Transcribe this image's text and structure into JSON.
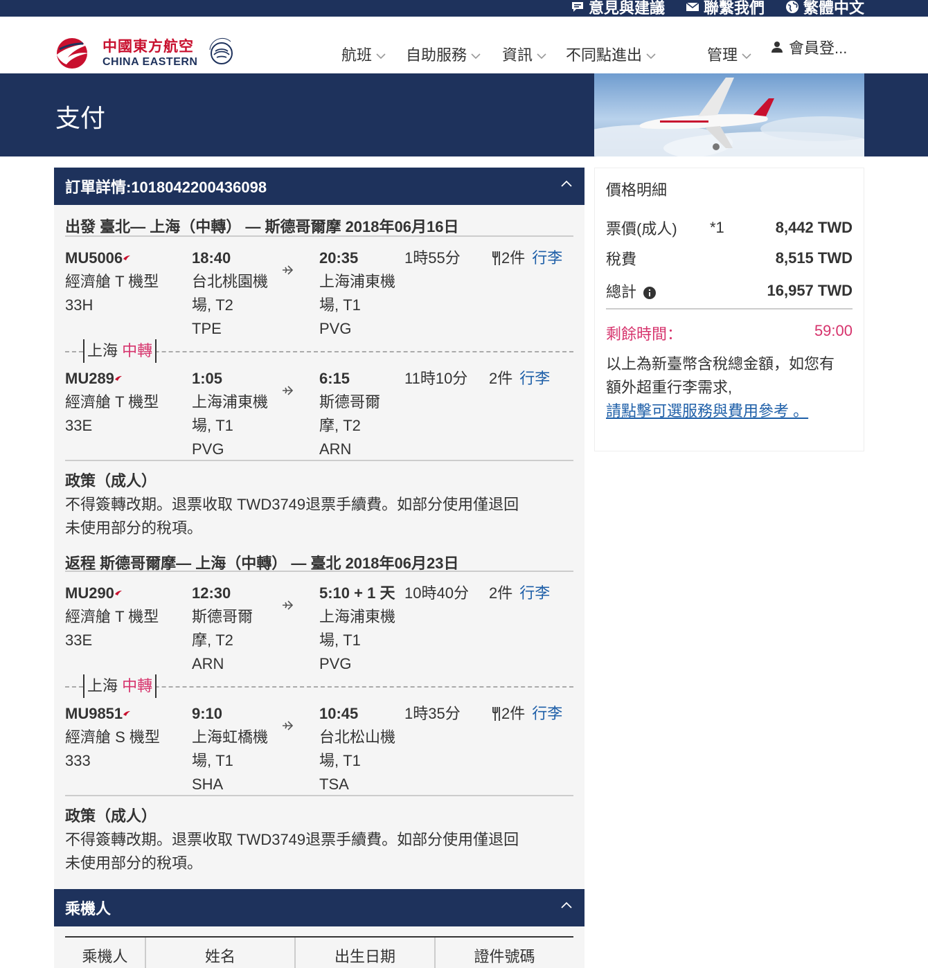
{
  "topbar": {
    "feedback": "意見與建議",
    "contact": "聯繫我們",
    "language": "繁體中文"
  },
  "brand": {
    "cn": "中國東方航空",
    "en": "CHINA EASTERN",
    "alliance": "SKYTEAM"
  },
  "nav": {
    "items": [
      "航班",
      "自助服務",
      "資訊",
      "不同點進出",
      "管理"
    ],
    "member": "會員登..."
  },
  "hero": {
    "title": "支付"
  },
  "order": {
    "header": "訂單詳情:1018042200436098",
    "outbound": {
      "title": "出發 臺北— 上海（中轉） — 斯德哥爾摩 2018年06月16日",
      "transfer_city": "上海",
      "transfer_label": "中轉",
      "flights": [
        {
          "number": "MU5006",
          "cabin": "經濟艙 T 機型",
          "aircraft": "33H",
          "dep_time": "18:40",
          "dep_airport_1": "台北桃園機",
          "dep_airport_2": "場, T2",
          "dep_code": "TPE",
          "arr_time": "20:35",
          "arr_airport_1": "上海浦東機",
          "arr_airport_2": "場, T1",
          "arr_code": "PVG",
          "duration": "1時55分",
          "bags": "2件",
          "bags_link": "行李"
        },
        {
          "number": "MU289",
          "cabin": "經濟艙 T 機型",
          "aircraft": "33E",
          "dep_time": "1:05",
          "dep_airport_1": "上海浦東機",
          "dep_airport_2": "場, T1",
          "dep_code": "PVG",
          "arr_time": "6:15",
          "arr_airport_1": "斯德哥爾",
          "arr_airport_2": "摩, T2",
          "arr_code": "ARN",
          "duration": "11時10分",
          "bags": "2件",
          "bags_link": "行李"
        }
      ],
      "policy_title": "政策（成人）",
      "policy_text_1": "不得簽轉改期。退票收取 TWD3749退票手續費。如部分使用僅退回",
      "policy_text_2": "未使用部分的稅項。"
    },
    "inbound": {
      "title": "返程 斯德哥爾摩— 上海（中轉） — 臺北 2018年06月23日",
      "transfer_city": "上海",
      "transfer_label": "中轉",
      "flights": [
        {
          "number": "MU290",
          "cabin": "經濟艙 T 機型",
          "aircraft": "33E",
          "dep_time": "12:30",
          "dep_airport_1": "斯德哥爾",
          "dep_airport_2": "摩, T2",
          "dep_code": "ARN",
          "arr_time": "5:10 + 1 天",
          "arr_airport_1": "上海浦東機",
          "arr_airport_2": "場, T1",
          "arr_code": "PVG",
          "duration": "10時40分",
          "bags": "2件",
          "bags_link": "行李"
        },
        {
          "number": "MU9851",
          "cabin": "經濟艙 S 機型",
          "aircraft": "333",
          "dep_time": "9:10",
          "dep_airport_1": "上海虹橋機",
          "dep_airport_2": "場, T1",
          "dep_code": "SHA",
          "arr_time": "10:45",
          "arr_airport_1": "台北松山機",
          "arr_airport_2": "場, T1",
          "arr_code": "TSA",
          "duration": "1時35分",
          "bags": "2件",
          "bags_link": "行李"
        }
      ],
      "policy_title": "政策（成人）",
      "policy_text_1": "不得簽轉改期。退票收取 TWD3749退票手續費。如部分使用僅退回",
      "policy_text_2": "未使用部分的稅項。"
    }
  },
  "passengers": {
    "header": "乘機人",
    "columns": [
      "乘機人",
      "姓名",
      "出生日期",
      "證件號碼"
    ]
  },
  "price": {
    "title": "價格明細",
    "fare_label": "票價(成人)",
    "fare_qty": "*1",
    "fare_amount": "8,442 TWD",
    "tax_label": "稅費",
    "tax_amount": "8,515 TWD",
    "total_label": "總計",
    "total_amount": "16,957 TWD",
    "remaining_label": "剩餘時間：",
    "remaining_value": "59:00",
    "note_1": "以上為新臺幣含稅總金額，如您有",
    "note_2": "額外超重行李需求,",
    "note_link": "請點擊可選服務與費用參考 。"
  },
  "colors": {
    "navy": "#1e325c",
    "brand_red": "#c8102e",
    "accent_pink": "#d6336c",
    "link_blue": "#1e5fa8"
  }
}
